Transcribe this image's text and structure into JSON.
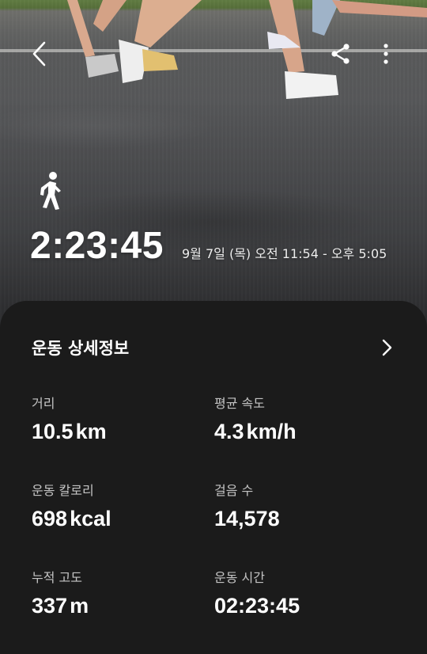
{
  "header": {
    "back_icon": "chevron-left-icon",
    "share_icon": "share-icon",
    "more_icon": "more-vertical-icon"
  },
  "summary": {
    "activity_icon": "walking-person-icon",
    "duration": "2:23:45",
    "date_range": "9월 7일 (목) 오전 11:54 - 오후 5:05"
  },
  "details": {
    "title": "운동 상세정보",
    "chevron_icon": "chevron-right-icon",
    "stats": {
      "distance": {
        "label": "거리",
        "value": "10.5",
        "unit": "km"
      },
      "avg_speed": {
        "label": "평균 속도",
        "value": "4.3",
        "unit": "km/h"
      },
      "calories": {
        "label": "운동 칼로리",
        "value": "698",
        "unit": "kcal"
      },
      "steps": {
        "label": "걸음 수",
        "value": "14,578"
      },
      "elevation": {
        "label": "누적 고도",
        "value": "337",
        "unit": "m"
      },
      "workout_time": {
        "label": "운동 시간",
        "value": "02:23:45"
      }
    }
  },
  "colors": {
    "card_background": "#1b1b1b",
    "label_text": "#c4c4c4",
    "primary_text": "#ffffff"
  }
}
